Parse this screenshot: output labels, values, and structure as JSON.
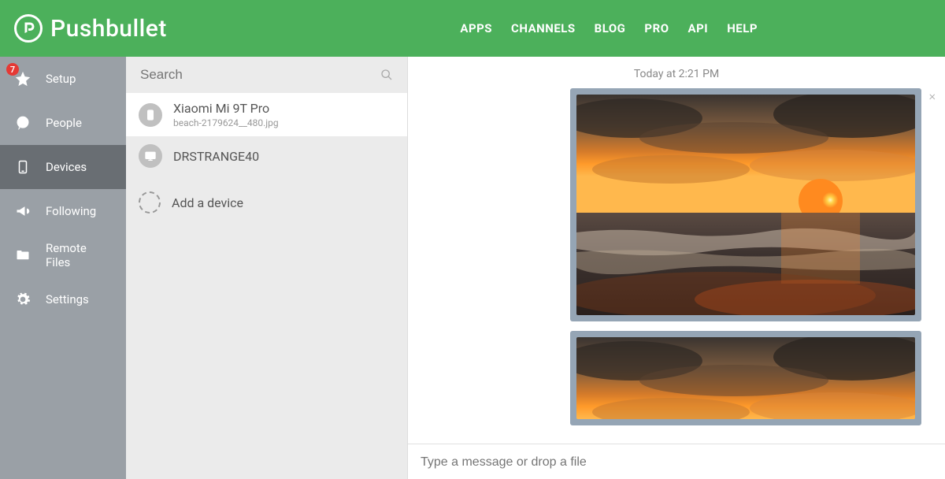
{
  "header": {
    "brand": "Pushbullet",
    "nav": [
      "APPS",
      "CHANNELS",
      "BLOG",
      "PRO",
      "API",
      "HELP"
    ]
  },
  "sidebar": {
    "badge": "7",
    "items": [
      {
        "label": "Setup",
        "icon": "star"
      },
      {
        "label": "People",
        "icon": "chat"
      },
      {
        "label": "Devices",
        "icon": "phone"
      },
      {
        "label": "Following",
        "icon": "megaphone"
      },
      {
        "label": "Remote Files",
        "icon": "folder"
      },
      {
        "label": "Settings",
        "icon": "gear"
      }
    ]
  },
  "search": {
    "placeholder": "Search"
  },
  "devices": [
    {
      "name": "Xiaomi Mi 9T Pro",
      "sub": "beach-2179624__480.jpg",
      "type": "phone"
    },
    {
      "name": "DRSTRANGE40",
      "sub": "",
      "type": "desktop"
    },
    {
      "name": "Add a device",
      "sub": "",
      "type": "add"
    }
  ],
  "content": {
    "timestamp": "Today at 2:21 PM",
    "input_placeholder": "Type a message or drop a file"
  }
}
